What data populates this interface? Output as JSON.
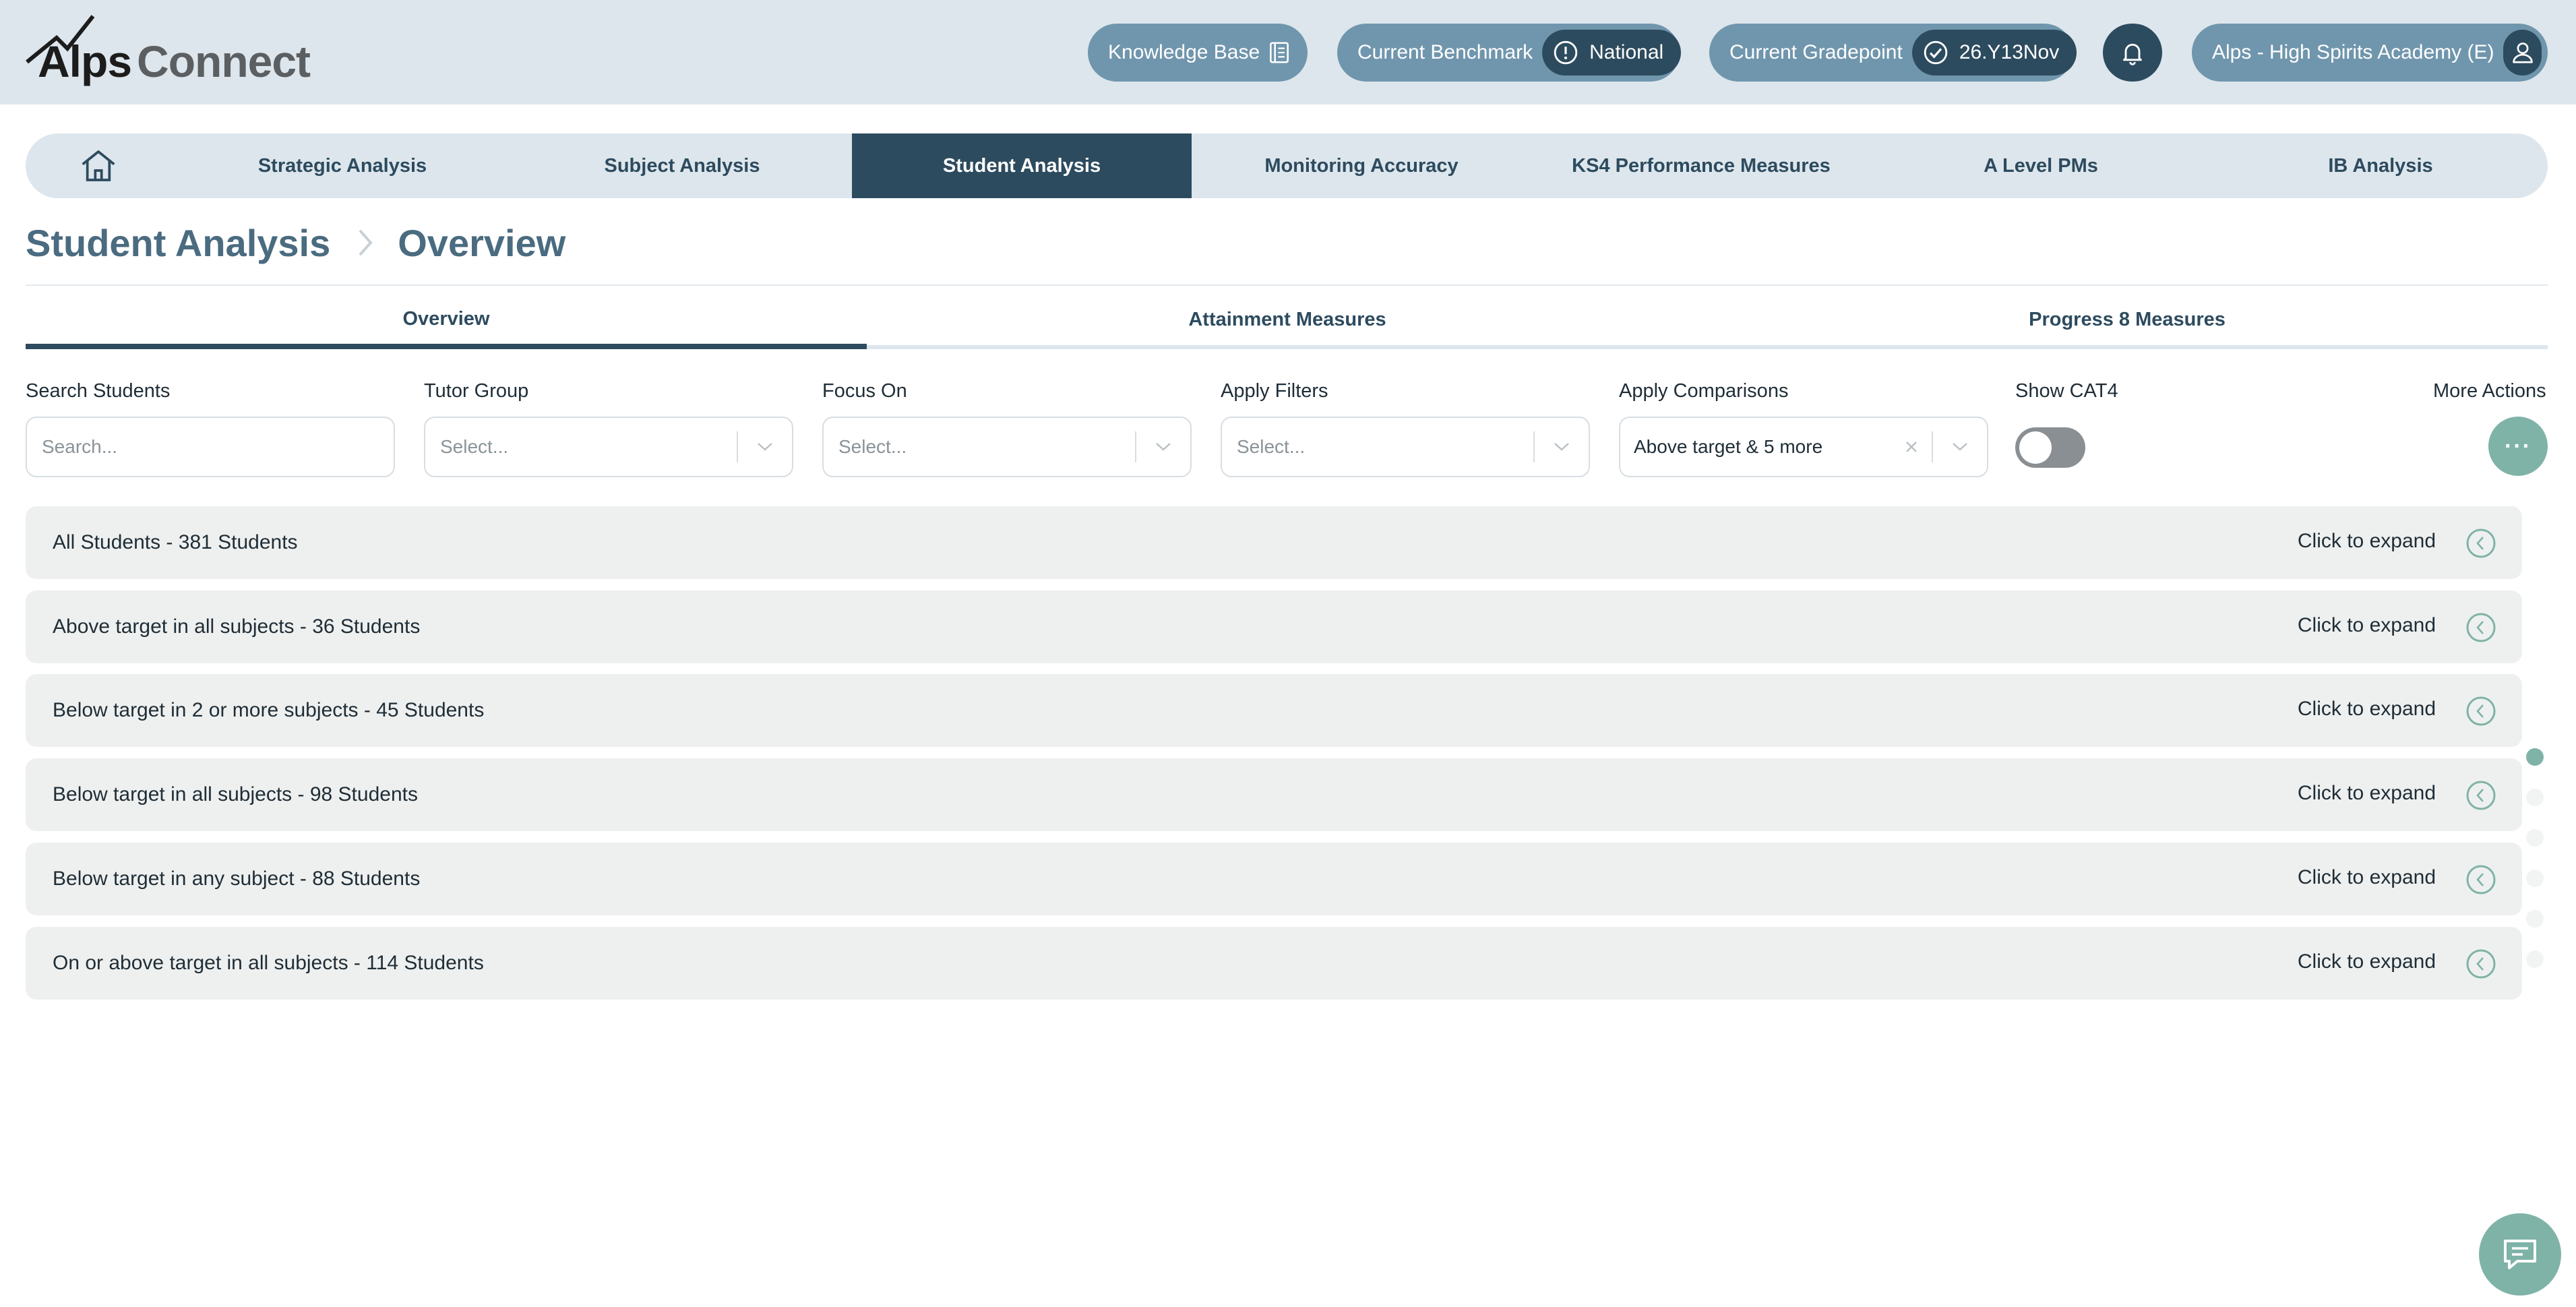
{
  "header": {
    "logo": {
      "part1": "Alps",
      "part2": "Connect"
    },
    "knowledge_base": {
      "label": "Knowledge Base",
      "icon": "book-icon"
    },
    "benchmark": {
      "label": "Current Benchmark",
      "value": "National",
      "icon": "alert-circle-icon"
    },
    "gradepoint": {
      "label": "Current Gradepoint",
      "value": "26.Y13Nov",
      "icon": "check-circle-icon"
    },
    "notifications": {
      "icon": "bell-icon"
    },
    "school": {
      "label": "Alps - High Spirits Academy (E)",
      "icon": "user-icon"
    }
  },
  "nav": {
    "home_icon": "home-icon",
    "items": [
      {
        "label": "Strategic Analysis"
      },
      {
        "label": "Subject Analysis"
      },
      {
        "label": "Student Analysis",
        "active": true
      },
      {
        "label": "Monitoring Accuracy"
      },
      {
        "label": "KS4 Performance Measures"
      },
      {
        "label": "A Level PMs"
      },
      {
        "label": "IB Analysis"
      }
    ]
  },
  "breadcrumb": {
    "section": "Student Analysis",
    "page": "Overview"
  },
  "subtabs": [
    {
      "label": "Overview",
      "active": true
    },
    {
      "label": "Attainment Measures"
    },
    {
      "label": "Progress 8 Measures"
    }
  ],
  "filters": {
    "search": {
      "label": "Search Students",
      "placeholder": "Search..."
    },
    "tutor_group": {
      "label": "Tutor Group",
      "placeholder": "Select..."
    },
    "focus_on": {
      "label": "Focus On",
      "placeholder": "Select..."
    },
    "apply_filters": {
      "label": "Apply Filters",
      "placeholder": "Select..."
    },
    "apply_comparisons": {
      "label": "Apply Comparisons",
      "value": "Above target & 5 more"
    },
    "show_cat4": {
      "label": "Show CAT4",
      "on": false
    },
    "more_actions": {
      "label": "More Actions",
      "button": "···"
    }
  },
  "groups": {
    "expand_label": "Click to expand",
    "items": [
      {
        "title": "All Students - 381 Students"
      },
      {
        "title": "Above target in all subjects - 36 Students"
      },
      {
        "title": "Below target in 2 or more subjects - 45 Students"
      },
      {
        "title": "Below target in all subjects - 98 Students"
      },
      {
        "title": "Below target in any subject - 88 Students"
      },
      {
        "title": "On or above target in all subjects - 114 Students"
      }
    ]
  },
  "scroll_dots": {
    "count": 6,
    "active_index": 0
  },
  "chat": {
    "icon": "chat-icon"
  },
  "colors": {
    "primary": "#2d4b5f",
    "pill": "#7096ad",
    "accent": "#7fb3a7",
    "header_bg": "#dde6ec",
    "row_bg": "#eef0ef"
  }
}
